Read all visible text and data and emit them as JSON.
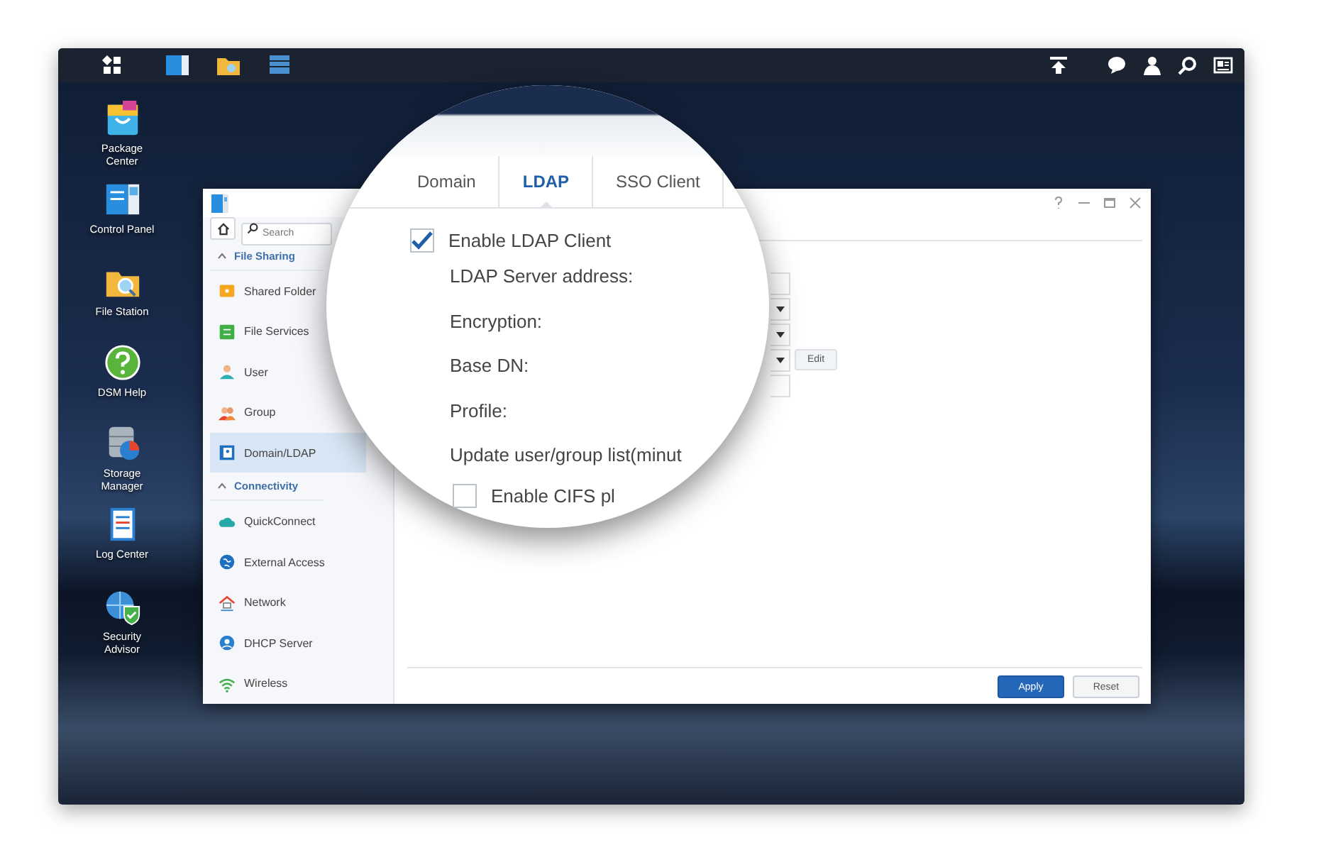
{
  "desktop_icons": [
    {
      "kind": "package",
      "label": "Package Center"
    },
    {
      "kind": "control",
      "label": "Control Panel"
    },
    {
      "kind": "files",
      "label": "File Station"
    },
    {
      "kind": "help",
      "label": "DSM Help"
    },
    {
      "kind": "storage",
      "label": "Storage Manager"
    },
    {
      "kind": "log",
      "label": "Log Center"
    },
    {
      "kind": "security",
      "label": "Security Advisor"
    }
  ],
  "window": {
    "search": {
      "placeholder": "Search"
    },
    "sections": [
      {
        "title": "File Sharing",
        "expanded": true,
        "items": [
          {
            "kind": "shared-folder",
            "label": "Shared Folder",
            "selected": false
          },
          {
            "kind": "file-services",
            "label": "File Services",
            "selected": false
          },
          {
            "kind": "user",
            "label": "User",
            "selected": false
          },
          {
            "kind": "group",
            "label": "Group",
            "selected": false
          },
          {
            "kind": "domain",
            "label": "Domain/LDAP",
            "selected": true
          }
        ]
      },
      {
        "title": "Connectivity",
        "expanded": true,
        "items": [
          {
            "kind": "quickconnect",
            "label": "QuickConnect",
            "selected": false
          },
          {
            "kind": "external",
            "label": "External Access",
            "selected": false
          },
          {
            "kind": "network",
            "label": "Network",
            "selected": false
          },
          {
            "kind": "dhcp",
            "label": "DHCP Server",
            "selected": false
          },
          {
            "kind": "wireless",
            "label": "Wireless",
            "selected": false
          }
        ]
      }
    ],
    "fields": [
      {
        "kind": "text"
      },
      {
        "kind": "select"
      },
      {
        "kind": "select"
      },
      {
        "kind": "select",
        "button": "Edit"
      },
      {
        "kind": "text"
      }
    ],
    "buttons": [
      {
        "kind": "primary",
        "label": "Apply"
      },
      {
        "kind": "secondary",
        "label": "Reset"
      }
    ]
  },
  "magnifier": {
    "tabs": [
      {
        "label": "Domain",
        "selected": false
      },
      {
        "label": "LDAP",
        "selected": true
      },
      {
        "label": "SSO Client",
        "selected": false
      }
    ],
    "enable": {
      "label": "Enable LDAP Client",
      "checked": true
    },
    "labels": [
      "LDAP Server address:",
      "Encryption:",
      "Base DN:",
      "Profile:",
      "Update user/group list(minut"
    ],
    "cifs": {
      "label": "Enable CIFS pl",
      "checked": false
    }
  }
}
